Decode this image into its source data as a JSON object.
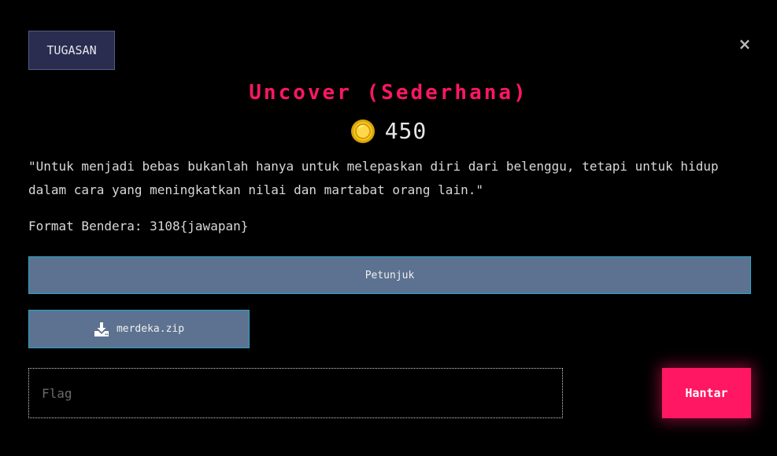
{
  "modal": {
    "tab_label": "TUGASAN",
    "close_symbol": "×",
    "title": "Uncover (Sederhana)",
    "points": "450",
    "description": "\"Untuk menjadi bebas bukanlah hanya untuk melepaskan diri dari belenggu, tetapi untuk hidup dalam cara yang meningkatkan nilai dan martabat orang lain.\"",
    "flag_format": "Format Bendera: 3108{jawapan}",
    "hint_label": "Petunjuk",
    "file_name": "merdeka.zip",
    "flag_placeholder": "Flag",
    "flag_value": "",
    "submit_label": "Hantar"
  },
  "icons": {
    "close": "close-icon",
    "coin": "coin-icon",
    "download": "download-icon"
  },
  "colors": {
    "accent": "#ff1764",
    "background": "#000000",
    "tab_bg": "#2a2d4f",
    "button_bg": "#5c7290",
    "button_border": "#27a7c7",
    "coin": "#f5c518"
  }
}
